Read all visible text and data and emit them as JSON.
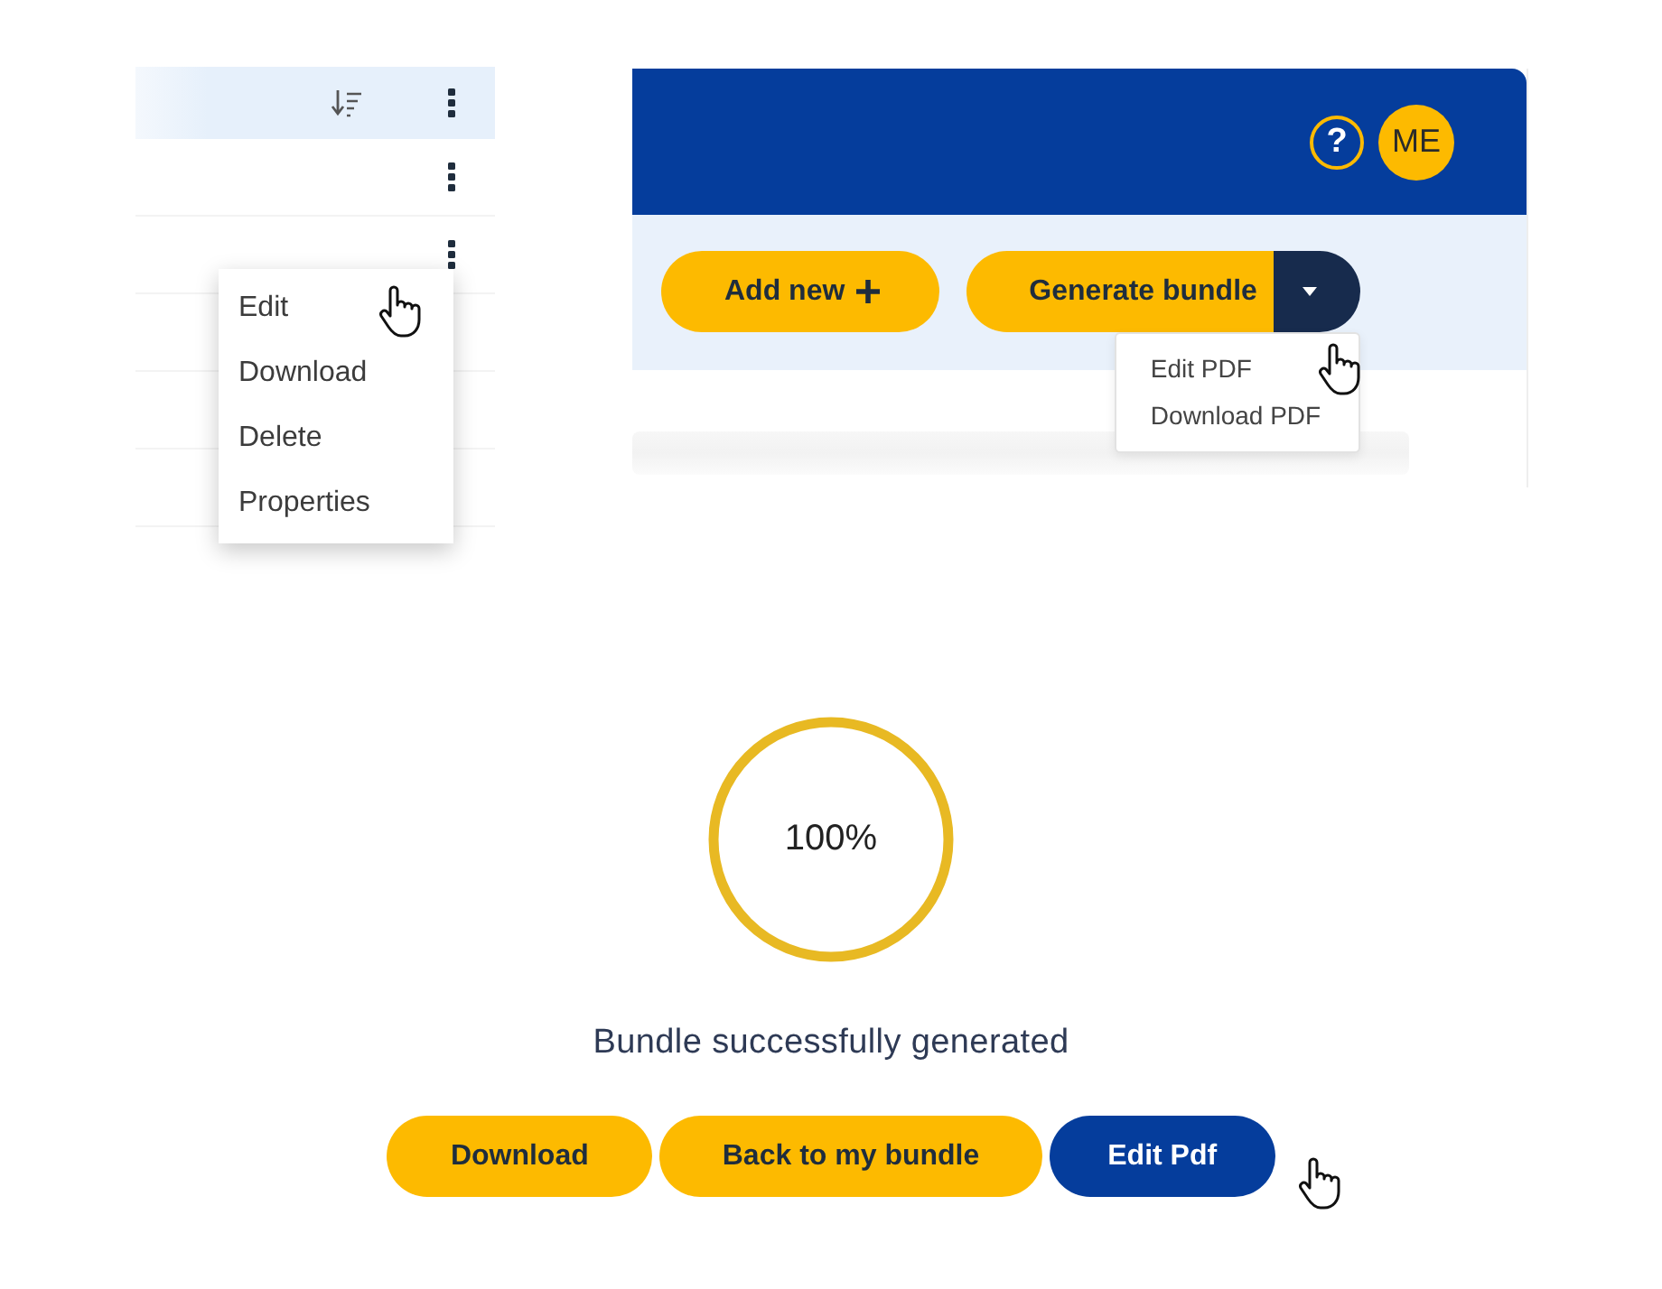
{
  "list": {
    "rows": [
      {
        "kind": "header",
        "expanded": false
      },
      {
        "kind": "item",
        "expanded": false
      },
      {
        "kind": "item",
        "expanded": true
      }
    ],
    "row_menu": {
      "items": [
        "Edit",
        "Download",
        "Delete",
        "Properties"
      ]
    }
  },
  "header": {
    "help": "?",
    "avatar": "ME"
  },
  "toolbar": {
    "add_button": "Add new",
    "generate_button": "Generate bundle",
    "dropdown": {
      "expanded": true,
      "items": [
        "Edit PDF",
        "Download PDF"
      ]
    }
  },
  "progress": {
    "level": 1,
    "reading": "100%",
    "message": "Bundle successfully generated"
  },
  "actions": [
    {
      "label": "Download",
      "kind": "secondary"
    },
    {
      "label": "Back to my bundle",
      "kind": "secondary"
    },
    {
      "label": "Edit Pdf",
      "kind": "primary"
    }
  ]
}
